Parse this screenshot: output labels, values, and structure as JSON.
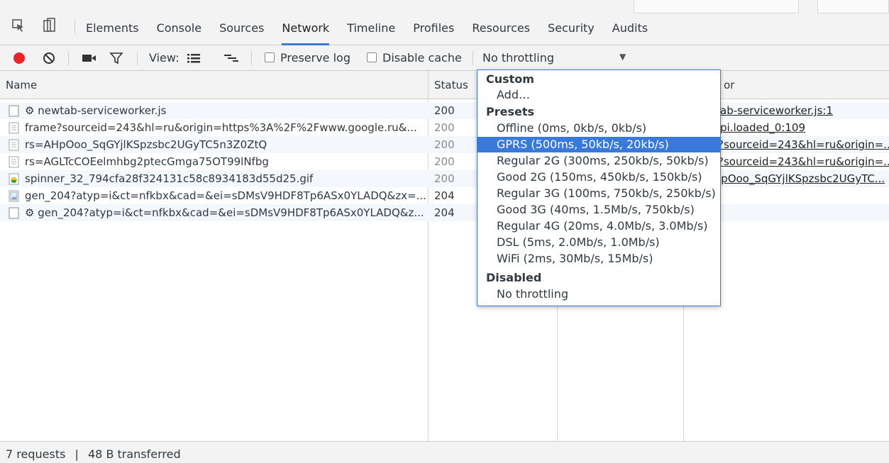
{
  "tabs": [
    "Elements",
    "Console",
    "Sources",
    "Network",
    "Timeline",
    "Profiles",
    "Resources",
    "Security",
    "Audits"
  ],
  "active_tab": "Network",
  "toolbar": {
    "view_label": "View:",
    "preserve_log": "Preserve log",
    "disable_cache": "Disable cache",
    "throttling_value": "No throttling",
    "dropdown_arrow": "▼"
  },
  "columns": {
    "name": "Name",
    "status": "Status",
    "initiator": "or"
  },
  "rows": [
    {
      "icon": "service-worker-icon",
      "name": "⚙ newtab-serviceworker.js",
      "status": "200",
      "initiator": "ab-serviceworker.js:1"
    },
    {
      "icon": "document-icon",
      "name": "frame?sourceid=243&hl=ru&origin=https%3A%2F%2Fwww.google.ru&...",
      "status": "200",
      "initiator": "pi.loaded_0:109"
    },
    {
      "icon": "document-icon",
      "name": "rs=AHpOoo_SqGYjlKSpzsbc2UGyTC5n3Z0ZtQ",
      "status": "200",
      "initiator": "?sourceid=243&hl=ru&origin=..."
    },
    {
      "icon": "document-icon",
      "name": "rs=AGLTcCOEelmhbg2ptecGmga75OT99lNfbg",
      "status": "200",
      "initiator": "?sourceid=243&hl=ru&origin=..."
    },
    {
      "icon": "image-icon",
      "name": "spinner_32_794cfa28f324131c58c8934183d55d25.gif",
      "status": "200",
      "initiator": "lpOoo_SqGYjlKSpzsbc2UGyTC..."
    },
    {
      "icon": "image-file-icon",
      "name": "gen_204?atyp=i&ct=nfkbx&cad=&ei=sDMsV9HDF8Tp6ASx0YLADQ&zx=...",
      "status": "204",
      "initiator": ""
    },
    {
      "icon": "service-worker-icon",
      "name": "⚙ gen_204?atyp=i&ct=nfkbx&cad=&ei=sDMsV9HDF8Tp6ASx0YLADQ&z...",
      "status": "204",
      "initiator": ""
    }
  ],
  "footer": {
    "requests": "7 requests",
    "separator": "|",
    "transferred": "48 B transferred"
  },
  "throttling_menu": {
    "custom_header": "Custom",
    "add": "Add…",
    "presets_header": "Presets",
    "presets": [
      "Offline (0ms, 0kb/s, 0kb/s)",
      "GPRS (500ms, 50kb/s, 20kb/s)",
      "Regular 2G (300ms, 250kb/s, 50kb/s)",
      "Good 2G (150ms, 450kb/s, 150kb/s)",
      "Regular 3G (100ms, 750kb/s, 250kb/s)",
      "Good 3G (40ms, 1.5Mb/s, 750kb/s)",
      "Regular 4G (20ms, 4.0Mb/s, 3.0Mb/s)",
      "DSL (5ms, 2.0Mb/s, 1.0Mb/s)",
      "WiFi (2ms, 30Mb/s, 15Mb/s)"
    ],
    "selected": "GPRS (500ms, 50kb/s, 20kb/s)",
    "disabled_header": "Disabled",
    "no_throttling": "No throttling"
  },
  "colors": {
    "accent": "#3879d9",
    "record": "#e8242b"
  }
}
